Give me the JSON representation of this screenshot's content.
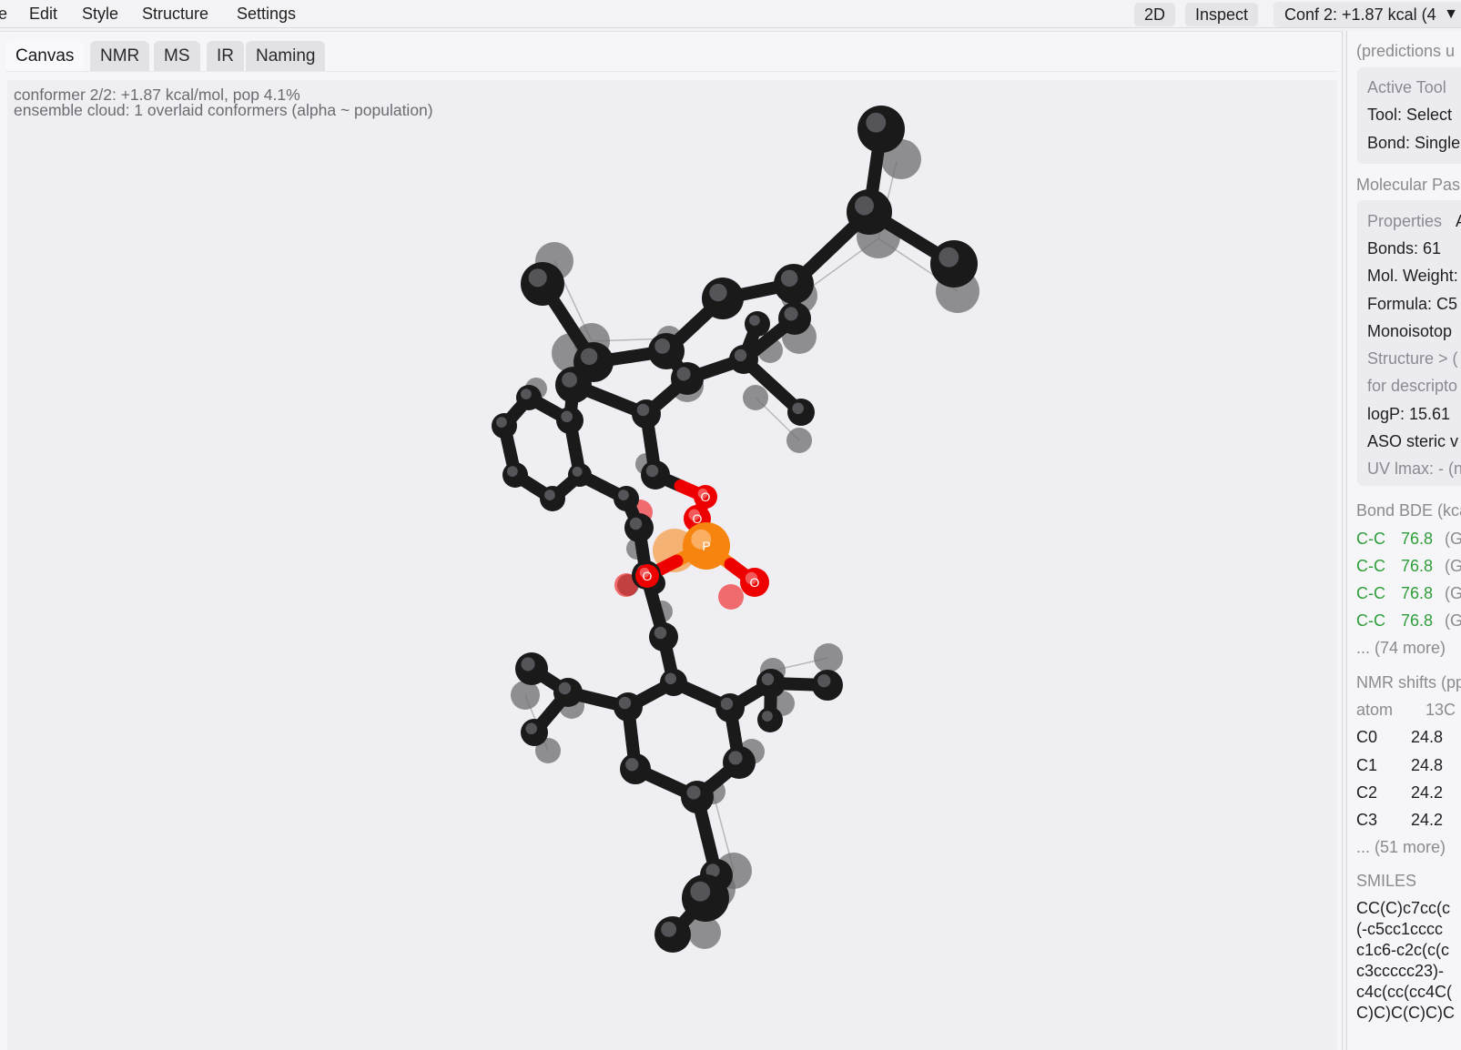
{
  "menu": {
    "file_partial": "e",
    "edit": "Edit",
    "style": "Style",
    "structure": "Structure",
    "settings": "Settings"
  },
  "toolbar": {
    "mode_2d": "2D",
    "inspect": "Inspect",
    "conformer_select": "Conf 2: +1.87 kcal (4",
    "dropdown_arrow": "▼"
  },
  "tabs": [
    "Canvas",
    "NMR",
    "MS",
    "IR",
    "Naming"
  ],
  "canvas": {
    "info_line1": "conformer 2/2: +1.87 kcal/mol, pop 4.1%",
    "info_line2": "ensemble cloud: 1 overlaid conformers (alpha ~ population)"
  },
  "colors": {
    "carbon": "#1a1a1a",
    "ghost": "#6d6d70",
    "oxygen": "#ee0000",
    "phosphorus": "#f7840f",
    "green_value": "#2e9e3a"
  },
  "right_panel": {
    "predictions_note": "(predictions u",
    "active_tool_header": "Active Tool",
    "tool_line": "Tool: Select",
    "bond_line": "Bond: Single",
    "molecular_header": "Molecular Pas",
    "properties_header": "Properties",
    "properties_trailing": "A",
    "bonds": "Bonds: 61",
    "mol_weight": "Mol. Weight:",
    "formula": "Formula: C5",
    "monoisotopic": "Monoisotop",
    "structure_note": "Structure > (",
    "descriptor_note": "for descripto",
    "logp": "logP: 15.61",
    "aso": "ASO steric v",
    "uv": "UV lmax: - (n",
    "bde_header": "Bond BDE (kca",
    "bde_rows": [
      {
        "bond": "C-C",
        "value": "76.8",
        "method": "(G"
      },
      {
        "bond": "C-C",
        "value": "76.8",
        "method": "(G"
      },
      {
        "bond": "C-C",
        "value": "76.8",
        "method": "(G"
      },
      {
        "bond": "C-C",
        "value": "76.8",
        "method": "(G"
      }
    ],
    "bde_more": "... (74 more)",
    "nmr_header": "NMR shifts (pp",
    "nmr_col_atom": "atom",
    "nmr_col_13c": "13C",
    "nmr_rows": [
      {
        "atom": "C0",
        "shift": "24.8"
      },
      {
        "atom": "C1",
        "shift": "24.8"
      },
      {
        "atom": "C2",
        "shift": "24.2"
      },
      {
        "atom": "C3",
        "shift": "24.2"
      }
    ],
    "nmr_more": "... (51 more)",
    "smiles_header": "SMILES",
    "smiles_lines": [
      "CC(C)c7cc(c",
      "(-c5cc1cccc",
      "c1c6-c2c(c(c",
      "c3ccccc23)-",
      "c4c(cc(cc4C(",
      "C)C)C(C)C)C"
    ]
  },
  "atom_labels": {
    "oxygen": "O",
    "phosphorus": "P"
  }
}
